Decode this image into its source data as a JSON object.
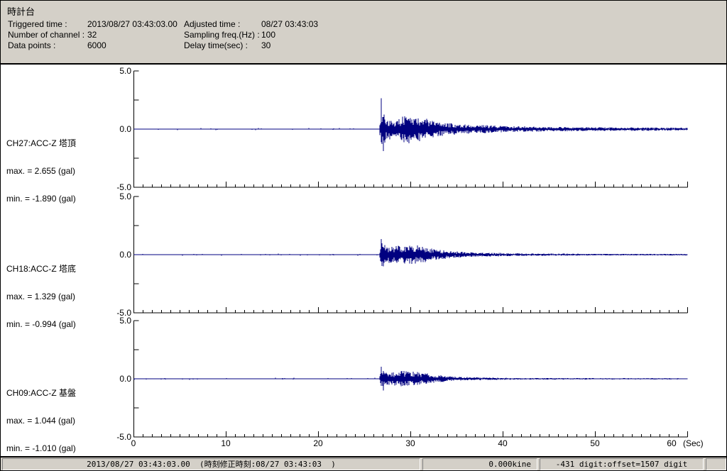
{
  "header": {
    "title": "時計台",
    "fields": [
      {
        "label": "Triggered time :",
        "value": "2013/08/27 03:43:03.00"
      },
      {
        "label": "Adjusted time :",
        "value": "08/27 03:43:03"
      },
      {
        "label": "Number of channel :",
        "value": "32"
      },
      {
        "label": "Sampling freq.(Hz) :",
        "value": "100"
      },
      {
        "label": "Data points :",
        "value": "6000"
      },
      {
        "label": "Delay time(sec) :",
        "value": "30"
      }
    ]
  },
  "chart_data": {
    "type": "line",
    "title": "時計台 acceleration waveforms (3 channels)",
    "x_label_unit": "(Sec)",
    "x_ticks": [
      0,
      10,
      20,
      30,
      40,
      50,
      60
    ],
    "x_range_sec": [
      0,
      60
    ],
    "y_range_gal": [
      -5,
      5
    ],
    "y_tick_labels": [
      "5.0",
      "0.0",
      "-5.0"
    ],
    "sampling_freq_hz": 100,
    "data_points": 6000,
    "event_onset_sec": 26.8,
    "waveform_color": "#000080",
    "channels": [
      {
        "name": "CH27:ACC-Z 塔頂",
        "max_label": "max. = 2.655 (gal)",
        "min_label": "min. = -1.890 (gal)",
        "max_gal": 2.655,
        "min_gal": -1.89,
        "amplitude_envelope_gal": [
          [
            0,
            0.045
          ],
          [
            26.55,
            0.045
          ],
          [
            26.8,
            1.9
          ],
          [
            27.2,
            1.1
          ],
          [
            28.0,
            0.75
          ],
          [
            28.8,
            0.95
          ],
          [
            29.6,
            1.35
          ],
          [
            30.3,
            1.0
          ],
          [
            31.2,
            1.05
          ],
          [
            32.0,
            0.8
          ],
          [
            33.0,
            0.6
          ],
          [
            34.5,
            0.5
          ],
          [
            36.0,
            0.42
          ],
          [
            38.0,
            0.34
          ],
          [
            40.0,
            0.28
          ],
          [
            43.0,
            0.22
          ],
          [
            46.0,
            0.19
          ],
          [
            50.0,
            0.16
          ],
          [
            55.0,
            0.14
          ],
          [
            60,
            0.13
          ]
        ]
      },
      {
        "name": "CH18:ACC-Z 塔底",
        "max_label": "max. = 1.329 (gal)",
        "min_label": "min. = -0.994 (gal)",
        "max_gal": 1.329,
        "min_gal": -0.994,
        "amplitude_envelope_gal": [
          [
            0,
            0.04
          ],
          [
            26.55,
            0.04
          ],
          [
            26.8,
            1.0
          ],
          [
            27.3,
            0.75
          ],
          [
            28.0,
            0.7
          ],
          [
            28.8,
            0.85
          ],
          [
            29.6,
            0.8
          ],
          [
            30.4,
            0.85
          ],
          [
            31.2,
            0.7
          ],
          [
            32.2,
            0.55
          ],
          [
            33.2,
            0.42
          ],
          [
            34.2,
            0.32
          ],
          [
            35.5,
            0.26
          ],
          [
            37.0,
            0.2
          ],
          [
            39.0,
            0.15
          ],
          [
            41.0,
            0.12
          ],
          [
            44.0,
            0.1
          ],
          [
            48.0,
            0.08
          ],
          [
            53.0,
            0.07
          ],
          [
            60,
            0.065
          ]
        ]
      },
      {
        "name": "CH09:ACC-Z 基盤",
        "max_label": "max. = 1.044 (gal)",
        "min_label": "min. = -1.010 (gal)",
        "max_gal": 1.044,
        "min_gal": -1.01,
        "amplitude_envelope_gal": [
          [
            0,
            0.04
          ],
          [
            26.55,
            0.04
          ],
          [
            26.8,
            0.8
          ],
          [
            27.3,
            0.6
          ],
          [
            28.0,
            0.55
          ],
          [
            28.8,
            0.7
          ],
          [
            29.5,
            0.65
          ],
          [
            30.2,
            0.7
          ],
          [
            31.0,
            0.55
          ],
          [
            32.0,
            0.42
          ],
          [
            33.0,
            0.32
          ],
          [
            34.0,
            0.22
          ],
          [
            35.0,
            0.17
          ],
          [
            36.5,
            0.13
          ],
          [
            38.5,
            0.1
          ],
          [
            41.0,
            0.08
          ],
          [
            45.0,
            0.06
          ],
          [
            50.0,
            0.055
          ],
          [
            60,
            0.05
          ]
        ]
      }
    ]
  },
  "status_bar": {
    "timestamp": "2013/08/27 03:43:03.00  (時刻修正時刻:08/27 03:43:03  )",
    "kine": "0.000kine",
    "digit": "-431 digit:offset=1507 digit"
  },
  "colors": {
    "chrome": "#d4d0c8",
    "plot_background": "#ffffff",
    "trace": "#000080",
    "axis": "#000000"
  }
}
